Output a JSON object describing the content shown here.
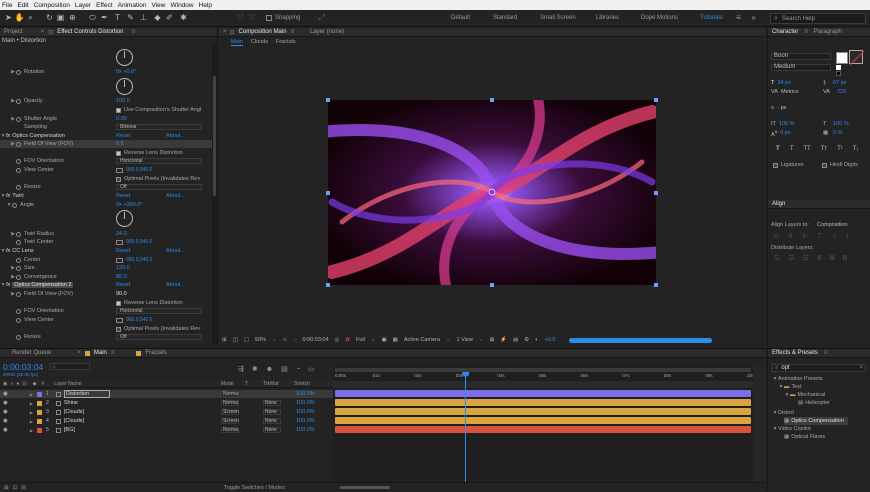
{
  "menubar": {
    "items": [
      "File",
      "Edit",
      "Composition",
      "Layer",
      "Effect",
      "Animation",
      "View",
      "Window",
      "Help"
    ]
  },
  "toolbar": {
    "snapping_label": "Snapping",
    "workspaces": [
      "Default",
      "Standard",
      "Small Screen",
      "Libraries",
      "Dope Motions",
      "Tutorials"
    ],
    "active_workspace": "Tutorials",
    "search_placeholder": "Search Help"
  },
  "effect_controls": {
    "tabs": {
      "project": "Project",
      "effect_controls": "Effect Controls Distortion"
    },
    "breadcrumb": "Main • Distortion",
    "properties": {
      "rotation": {
        "label": "Rotation",
        "value": "0x +0.0°"
      },
      "opacity": {
        "label": "Opacity",
        "value": "100.0"
      },
      "use_comp_shutter": "Use Composition's Shutter Angl",
      "shutter_angle": {
        "label": "Shutter Angle",
        "value": "0.00"
      },
      "sampling": {
        "label": "Sampling",
        "value": "Bilinear"
      },
      "optics1": {
        "label": "Optics Compensation",
        "reset": "Reset",
        "about": "About..."
      },
      "fov1": {
        "label": "Field Of View (FOV)",
        "value": "8.5"
      },
      "reverse1": "Reverse Lens Distortion",
      "fov_orient1": {
        "label": "FOV Orientation",
        "value": "Horizontal"
      },
      "view_center1": {
        "label": "View Center",
        "value": "960.0,540.0"
      },
      "optimal1": "Optimal Pixels (Invalidates Rev",
      "resize1": {
        "label": "Resize",
        "value": "Off"
      },
      "twirl": {
        "label": "Twirl",
        "reset": "Reset",
        "about": "About..."
      },
      "angle": {
        "label": "Angle",
        "value": "0x +390.0°"
      },
      "twirl_radius": {
        "label": "Twirl Radius",
        "value": "24.0"
      },
      "twirl_center": {
        "label": "Twirl Center",
        "value": "960.0,540.0"
      },
      "cc_lens": {
        "label": "CC Lens",
        "reset": "Reset",
        "about": "About..."
      },
      "center": {
        "label": "Center",
        "value": "960.0,540.0"
      },
      "size": {
        "label": "Size",
        "value": "120.0"
      },
      "convergence": {
        "label": "Convergence",
        "value": "85.0"
      },
      "optics2": {
        "label": "Optics Compensation 2",
        "reset": "Reset",
        "about": "About..."
      },
      "fov2": {
        "label": "Field Of View (FOV)",
        "value": "90.0"
      },
      "reverse2": "Reverse Lens Distortion",
      "fov_orient2": {
        "label": "FOV Orientation",
        "value": "Horizontal"
      },
      "view_center2": {
        "label": "View Center",
        "value": "960.0,540.0"
      },
      "optimal2": "Optimal Pixels (Invalidates Rev",
      "resize2": {
        "label": "Resize",
        "value": "Off"
      }
    }
  },
  "composition": {
    "tab_label": "Composition Main",
    "layer_tab": "Layer (none)",
    "subtabs": [
      "Main",
      "Clouds",
      "Fractals"
    ],
    "active_subtab": "Main",
    "footer": {
      "zoom": "50%",
      "timecode": "0:00:03:04",
      "resolution": "Full",
      "camera": "Active Camera",
      "view": "1 View",
      "exposure": "+0.0"
    }
  },
  "character": {
    "tabs": [
      "Character",
      "Paragraph"
    ],
    "font": "Boon",
    "style": "Medium",
    "size": "34 px",
    "leading": "67 px",
    "kerning": "Metrics",
    "tracking": "720",
    "stroke": "- px",
    "vscale": "100 %",
    "hscale": "100 %",
    "baseline": "0 px",
    "tsume": "0 %",
    "styles": [
      "T",
      "T",
      "TT",
      "Tт",
      "T¹",
      "T₁"
    ],
    "ligatures": "Ligatures",
    "hindi": "Hindi Digits"
  },
  "align": {
    "title": "Align",
    "align_to_label": "Align Layers to:",
    "align_to_value": "Composition",
    "distribute": "Distribute Layers:"
  },
  "effects_presets": {
    "title": "Effects & Presets",
    "search": "opt",
    "tree": [
      "Animation Presets",
      "Text",
      "Mechanical",
      "Helicopter",
      "Distort",
      "Optics Compensation",
      "Video Copilot",
      "Optical Flares"
    ],
    "selected": "Optics Compensation"
  },
  "timeline": {
    "tabs": [
      "Render Queue",
      "Main",
      "Fractals"
    ],
    "active_tab": "Main",
    "timecode": "0:00:03:04",
    "fps": "00094 (30.00 fps)",
    "columns": {
      "num": "#",
      "name": "Layer Name",
      "mode": "Mode",
      "trkmat": "TrkMat",
      "stretch": "Stretch",
      "t": "T"
    },
    "ruler": [
      "0:00s",
      "01s",
      "02s",
      "03s",
      "04s",
      "05s",
      "06s",
      "07s",
      "08s",
      "09s",
      "10s"
    ],
    "playhead_seconds": 3.13,
    "layers": [
      {
        "num": "1",
        "name": "Distortion",
        "mode": "Norma",
        "trkmat": "",
        "stretch": "100.0%",
        "color": "#7b6ee6",
        "selected": true
      },
      {
        "num": "2",
        "name": "Shine",
        "mode": "Norma",
        "trkmat": "None",
        "stretch": "100.0%",
        "color": "#d9a441",
        "selected": false
      },
      {
        "num": "3",
        "name": "[Clouds]",
        "mode": "Screen",
        "trkmat": "None",
        "stretch": "100.0%",
        "color": "#d9a441",
        "selected": false
      },
      {
        "num": "4",
        "name": "[Clouds]",
        "mode": "Screen",
        "trkmat": "None",
        "stretch": "100.0%",
        "color": "#d9a441",
        "selected": false
      },
      {
        "num": "5",
        "name": "[BG]",
        "mode": "Norma",
        "trkmat": "None",
        "stretch": "100.0%",
        "color": "#d9533c",
        "selected": false
      }
    ],
    "toggle_label": "Toggle Switches / Modes"
  }
}
